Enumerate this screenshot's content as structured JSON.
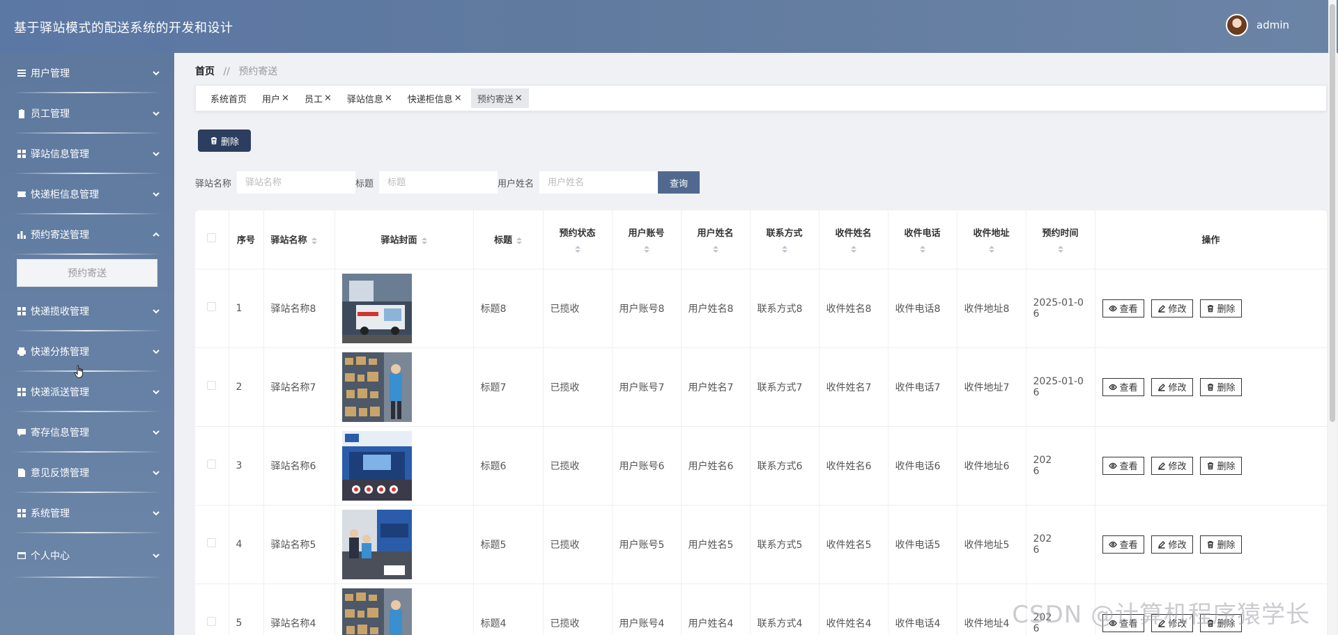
{
  "app": {
    "title": "基于驿站模式的配送系统的开发和设计"
  },
  "user": {
    "name": "admin"
  },
  "sidebar": {
    "items": [
      {
        "label": "用户管理",
        "icon": "list-icon"
      },
      {
        "label": "员工管理",
        "icon": "clipboard-icon"
      },
      {
        "label": "驿站信息管理",
        "icon": "grid-icon"
      },
      {
        "label": "快递柜信息管理",
        "icon": "ticket-icon"
      },
      {
        "label": "预约寄送管理",
        "icon": "bar-chart-icon",
        "expanded": true,
        "submenu": [
          "预约寄送"
        ]
      },
      {
        "label": "快递揽收管理",
        "icon": "grid-icon"
      },
      {
        "label": "快递分拣管理",
        "icon": "printer-icon"
      },
      {
        "label": "快递派送管理",
        "icon": "grid-icon"
      },
      {
        "label": "寄存信息管理",
        "icon": "chat-icon"
      },
      {
        "label": "意见反馈管理",
        "icon": "document-icon"
      },
      {
        "label": "系统管理",
        "icon": "grid-icon"
      },
      {
        "label": "个人中心",
        "icon": "card-icon"
      }
    ]
  },
  "breadcrumb": {
    "home": "首页",
    "separator": "//",
    "current": "预约寄送"
  },
  "tabs": [
    {
      "label": "系统首页",
      "closable": false
    },
    {
      "label": "用户",
      "closable": true
    },
    {
      "label": "员工",
      "closable": true
    },
    {
      "label": "驿站信息",
      "closable": true
    },
    {
      "label": "快递柜信息",
      "closable": true
    },
    {
      "label": "预约寄送",
      "closable": true,
      "active": true
    }
  ],
  "toolbar": {
    "delete_label": "删除"
  },
  "search": {
    "station_label": "驿站名称",
    "station_placeholder": "驿站名称",
    "title_label": "标题",
    "title_placeholder": "标题",
    "username_label": "用户姓名",
    "username_placeholder": "用户姓名",
    "query_label": "查询"
  },
  "table": {
    "headers": {
      "index": "序号",
      "station": "驿站名称",
      "cover": "驿站封面",
      "title": "标题",
      "status": "预约状态",
      "account": "用户账号",
      "username": "用户姓名",
      "contact": "联系方式",
      "recv_name": "收件姓名",
      "recv_phone": "收件电话",
      "recv_addr": "收件地址",
      "time": "预约时间",
      "ops": "操作"
    },
    "ops": {
      "view": "查看",
      "edit": "修改",
      "delete": "删除"
    },
    "rows": [
      {
        "index": "1",
        "station": "驿站名称8",
        "title": "标题8",
        "status": "已揽收",
        "account": "用户账号8",
        "username": "用户姓名8",
        "contact": "联系方式8",
        "recv_name": "收件姓名8",
        "recv_phone": "收件电话8",
        "recv_addr": "收件地址8",
        "time_line1": "2025-01-0",
        "time_line2": "6",
        "cover": "courier-van"
      },
      {
        "index": "2",
        "station": "驿站名称7",
        "title": "标题7",
        "status": "已揽收",
        "account": "用户账号7",
        "username": "用户姓名7",
        "contact": "联系方式7",
        "recv_name": "收件姓名7",
        "recv_phone": "收件电话7",
        "recv_addr": "收件地址7",
        "time_line1": "2025-01-0",
        "time_line2": "6",
        "cover": "parcel-shelves"
      },
      {
        "index": "3",
        "station": "驿站名称6",
        "title": "标题6",
        "status": "已揽收",
        "account": "用户账号6",
        "username": "用户姓名6",
        "contact": "联系方式6",
        "recv_name": "收件姓名6",
        "recv_phone": "收件电话6",
        "recv_addr": "收件地址6",
        "time_line1": "202",
        "time_line2": "6",
        "cover": "blue-station"
      },
      {
        "index": "4",
        "station": "驿站名称5",
        "title": "标题5",
        "status": "已揽收",
        "account": "用户账号5",
        "username": "用户姓名5",
        "contact": "联系方式5",
        "recv_name": "收件姓名5",
        "recv_phone": "收件电话5",
        "recv_addr": "收件地址5",
        "time_line1": "202",
        "time_line2": "6",
        "cover": "station-counter"
      },
      {
        "index": "5",
        "station": "驿站名称4",
        "title": "标题4",
        "status": "已揽收",
        "account": "用户账号4",
        "username": "用户姓名4",
        "contact": "联系方式4",
        "recv_name": "收件姓名4",
        "recv_phone": "收件电话4",
        "recv_addr": "收件地址4",
        "time_line1": "202",
        "time_line2": "6",
        "cover": "parcel-shelves"
      }
    ]
  },
  "watermark": "CSDN @计算机程序猿学长",
  "colors": {
    "header": "#5b77a4",
    "sidebar": "#6580a4",
    "primary_button": "#2c3e5f",
    "query_button": "#51698f"
  }
}
